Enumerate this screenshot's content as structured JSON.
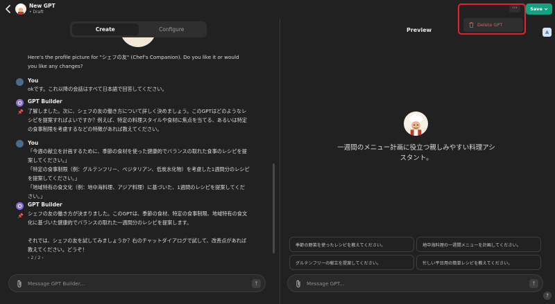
{
  "header": {
    "title": "New GPT",
    "status": "• Draft",
    "menu_label": "···",
    "save_label": "Save",
    "dropdown": {
      "delete_label": "Delete GPT"
    }
  },
  "builder": {
    "tabs": [
      {
        "label": "Create"
      },
      {
        "label": "Configure"
      }
    ],
    "messages": [
      {
        "sender": "",
        "text": "Here's the profile picture for \"シェフの友\" (Chef's Companion). Do you like it or would you like any changes?"
      },
      {
        "sender": "You",
        "text": "okです。これ以降の会話はすべて日本語で回答してください。"
      },
      {
        "sender": "GPT Builder",
        "text": "了解しました。次に、シェフの友の働き方について詳しく決めましょう。このGPTはどのようなレシピを提案すればよいですか？例えば、特定の料理スタイルや食材に焦点を当てる、あるいは特定の食事制限を考慮するなどの特徴があれば教えてください。"
      },
      {
        "sender": "You",
        "text": "「今週の献立を計画するために、季節の食材を使った健康的でバランスの取れた食事のレシピを提案してください。」\n「特定の食事制限（例：グルテンフリー、ベジタリアン、低炭水化物）を考慮した1週間分のレシピを提案してください。」\n「地域特有の食文化（例：地中海料理、アジア料理）に基づいた、1週間のレシピを提案してください。」"
      },
      {
        "sender": "GPT Builder",
        "text": "シェフの友の働き方が決まりました。このGPTは、季節の食材、特定の食事制限、地域特有の食文化に基づいた健康的でバランスの取れた一週間分のレシピを提案します。\n\nそれでは、シェフの友を試してみましょうか？右のチャットダイアログで試して、改善点があれば教えてください。どうぞ！"
      }
    ],
    "pagination": "‹ 2 / 2 ›",
    "composer_placeholder": "Message GPT Builder..."
  },
  "preview": {
    "title": "Preview",
    "description": "一週間のメニュー計画に役立つ親しみやすい料理アシスタント。",
    "starters": [
      "季節の野菜を使ったレシピを教えてください。",
      "地中海料理の一週間メニューを計画してください。",
      "グルテンフリーの献立を提案してください。",
      "忙しい平日用の簡単レシピを教えてください。"
    ],
    "composer_placeholder": "Message GPT...",
    "help_label": "?",
    "side_icon_label": "A"
  }
}
